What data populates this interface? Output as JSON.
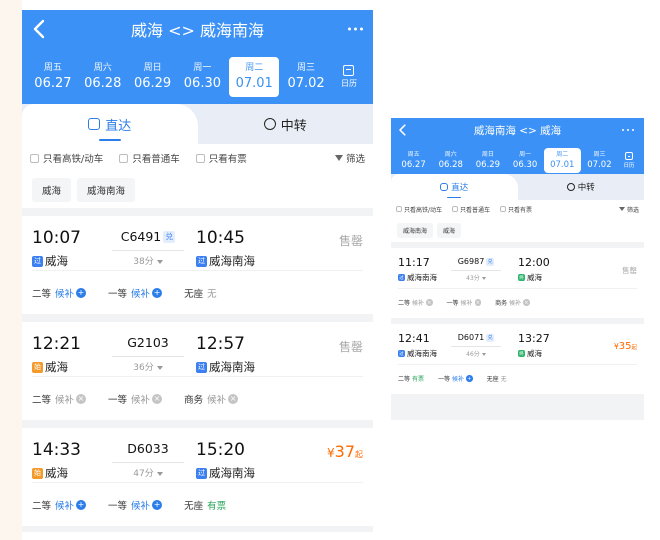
{
  "large": {
    "title": "威海 <> 威海南海",
    "dates": [
      {
        "weekday": "周五",
        "date": "06.27"
      },
      {
        "weekday": "周六",
        "date": "06.28"
      },
      {
        "weekday": "周日",
        "date": "06.29"
      },
      {
        "weekday": "周一",
        "date": "06.30"
      },
      {
        "weekday": "周二",
        "date": "07.01"
      },
      {
        "weekday": "周三",
        "date": "07.02"
      }
    ],
    "calendar_label": "日历",
    "tabs": {
      "direct": "直达",
      "transfer": "中转"
    },
    "filters": [
      "只看高铁/动车",
      "只看普通车",
      "只看有票"
    ],
    "filter_button": "筛选",
    "stations": [
      "威海",
      "威海南海"
    ],
    "trains": [
      {
        "dep_time": "10:07",
        "dep_badge": "过",
        "dep_station": "威海",
        "train_no": "C6491",
        "train_tag": "兑",
        "duration": "38分",
        "arr_time": "10:45",
        "arr_badge": "过",
        "arr_station": "威海南海",
        "price": "售罄",
        "seats": [
          {
            "name": "二等",
            "status": "候补"
          },
          {
            "name": "一等",
            "status": "候补"
          },
          {
            "name": "无座",
            "status": "无"
          }
        ]
      },
      {
        "dep_time": "12:21",
        "dep_badge": "始",
        "dep_station": "威海",
        "train_no": "G2103",
        "duration": "36分",
        "arr_time": "12:57",
        "arr_badge": "过",
        "arr_station": "威海南海",
        "price": "售罄",
        "seats": [
          {
            "name": "二等",
            "status": "候补"
          },
          {
            "name": "一等",
            "status": "候补"
          },
          {
            "name": "商务",
            "status": "候补"
          }
        ]
      },
      {
        "dep_time": "14:33",
        "dep_badge": "始",
        "dep_station": "威海",
        "train_no": "D6033",
        "duration": "47分",
        "arr_time": "15:20",
        "arr_badge": "过",
        "arr_station": "威海南海",
        "price_symbol": "¥",
        "price_value": "37",
        "price_suffix": "起",
        "seats": [
          {
            "name": "二等",
            "status": "候补"
          },
          {
            "name": "一等",
            "status": "候补"
          },
          {
            "name": "无座",
            "status": "有票"
          }
        ]
      }
    ]
  },
  "small": {
    "title": "威海南海 <> 威海",
    "dates": [
      {
        "weekday": "周五",
        "date": "06.27"
      },
      {
        "weekday": "周六",
        "date": "06.28"
      },
      {
        "weekday": "周日",
        "date": "06.29"
      },
      {
        "weekday": "周一",
        "date": "06.30"
      },
      {
        "weekday": "周二",
        "date": "07.01"
      },
      {
        "weekday": "周三",
        "date": "07.02"
      }
    ],
    "calendar_label": "日历",
    "tabs": {
      "direct": "直达",
      "transfer": "中转"
    },
    "filters": [
      "只看高铁/动车",
      "只看普通车",
      "只看有票"
    ],
    "filter_button": "筛选",
    "stations": [
      "威海南海",
      "威海"
    ],
    "trains": [
      {
        "dep_time": "11:17",
        "dep_badge": "过",
        "dep_station": "威海南海",
        "train_no": "G6987",
        "train_tag": "兑",
        "duration": "43分",
        "arr_time": "12:00",
        "arr_badge": "终",
        "arr_station": "威海",
        "price": "售罄",
        "seats": [
          {
            "name": "二等",
            "status": "候补"
          },
          {
            "name": "一等",
            "status": "候补"
          },
          {
            "name": "商务",
            "status": "候补"
          }
        ]
      },
      {
        "dep_time": "12:41",
        "dep_badge": "过",
        "dep_station": "威海南海",
        "train_no": "D6071",
        "train_tag": "兑",
        "duration": "46分",
        "arr_time": "13:27",
        "arr_badge": "终",
        "arr_station": "威海",
        "price_symbol": "¥",
        "price_value": "35",
        "price_suffix": "起",
        "seats": [
          {
            "name": "二等",
            "status": "有票"
          },
          {
            "name": "一等",
            "status": "候补"
          },
          {
            "name": "无座",
            "status": "无"
          }
        ]
      }
    ]
  },
  "colors": {
    "brand_blue": "#3b91f5",
    "price_orange": "#ff6a00",
    "ticket_green": "#25a55a"
  }
}
